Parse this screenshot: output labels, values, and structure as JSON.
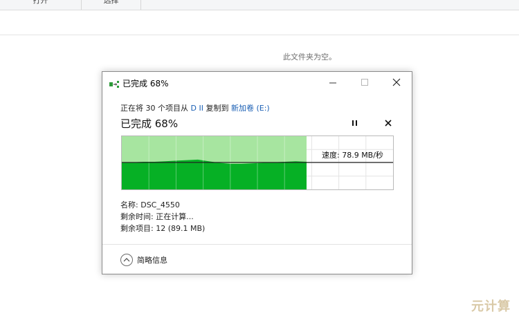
{
  "explorer": {
    "ribbon_open": "打开",
    "ribbon_select": "选择",
    "empty_message": "此文件夹为空。"
  },
  "watermark": "元计算",
  "dialog": {
    "title": "已完成 68%",
    "desc_prefix": "正在将 30 个项目从",
    "source": "D II",
    "desc_mid": "复制到",
    "destination": "新加卷 (E:)",
    "percent_text": "已完成 68%",
    "progress": 0.68,
    "speed_label": "速度: 78.9 MB/秒",
    "name_label": "名称:",
    "name_value": "DSC_4550",
    "time_label": "剩余时间:",
    "time_value": "正在计算...",
    "items_label": "剩余项目:",
    "items_value": "12 (89.1 MB)",
    "details_label": "简略信息"
  },
  "icons": {
    "app": "copy-file-icon",
    "minimize": "minimize-icon",
    "maximize": "maximize-icon",
    "close": "close-icon",
    "pause": "pause-icon",
    "stop": "stop-icon",
    "details": "chevron-up-icon"
  },
  "colors": {
    "progress_fill": "#06b025",
    "progress_bg": "#a7e5a0",
    "link": "#1a5fb4"
  }
}
